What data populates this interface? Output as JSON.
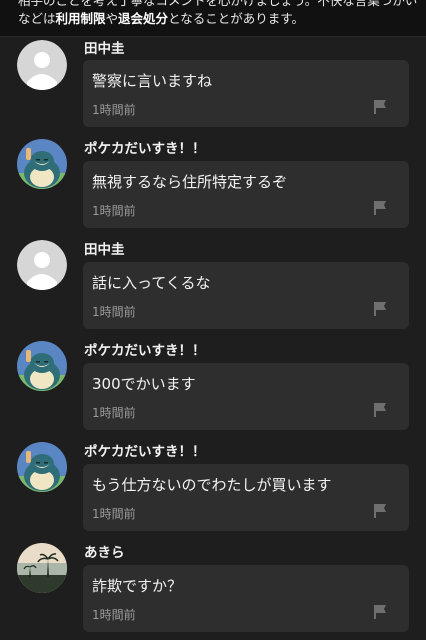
{
  "notice": {
    "line1": "相手のことを考え丁寧なコメントを心がけましょう。不快な言葉づかい",
    "line2_a": "などは",
    "line2_b": "利用制限",
    "line2_c": "や",
    "line2_d": "退会処分",
    "line2_e": "となることがあります。"
  },
  "comments": [
    {
      "user": "田中圭",
      "text": "警察に言いますね",
      "time": "1時間前",
      "avatar": "default-avatar"
    },
    {
      "user": "ポケカだいすき！！",
      "text": "無視するなら住所特定するぞ",
      "time": "1時間前",
      "avatar": "snorlax-avatar"
    },
    {
      "user": "田中圭",
      "text": "話に入ってくるな",
      "time": "1時間前",
      "avatar": "default-avatar"
    },
    {
      "user": "ポケカだいすき！！",
      "text": "300でかいます",
      "time": "1時間前",
      "avatar": "snorlax-avatar"
    },
    {
      "user": "ポケカだいすき！！",
      "text": "もう仕方ないのでわたしが買います",
      "time": "1時間前",
      "avatar": "snorlax-avatar"
    },
    {
      "user": "あきら",
      "text": "詐欺ですか？",
      "time": "1時間前",
      "avatar": "landscape-avatar"
    }
  ],
  "colors": {
    "background": "#1e1e1e",
    "bubble": "#2e2e2e",
    "timestamp": "#9a9a9a",
    "flag": "#6f6f6f"
  },
  "icons": {
    "report": "flag-icon"
  }
}
